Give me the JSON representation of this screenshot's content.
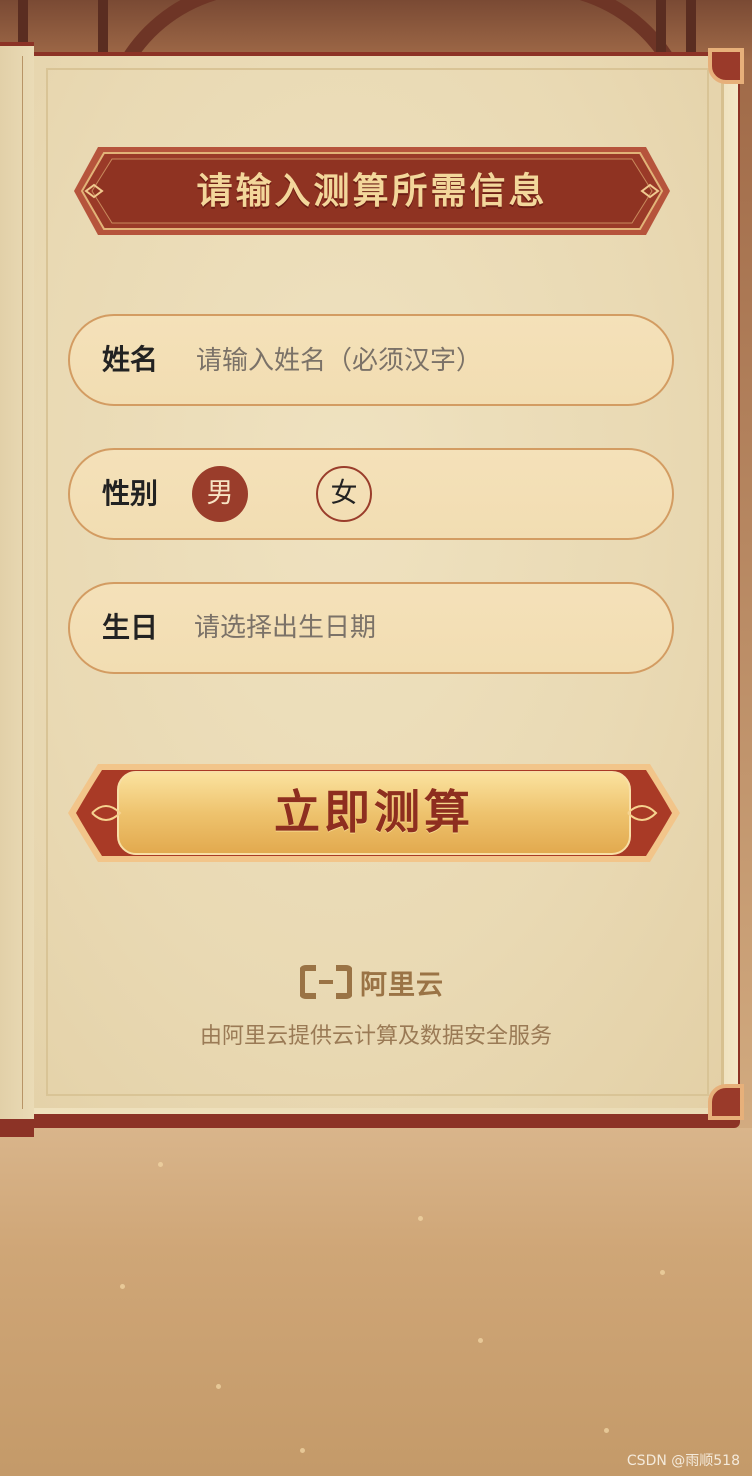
{
  "form": {
    "title": "请输入测算所需信息",
    "name": {
      "label": "姓名",
      "placeholder": "请输入姓名（必须汉字）",
      "value": ""
    },
    "gender": {
      "label": "性别",
      "options": [
        "男",
        "女"
      ],
      "selected": "男"
    },
    "birthday": {
      "label": "生日",
      "placeholder": "请选择出生日期"
    },
    "submit_label": "立即测算"
  },
  "footer": {
    "brand": "阿里云",
    "provider_text": "由阿里云提供云计算及数据安全服务"
  },
  "watermark": "CSDN @雨顺518",
  "colors": {
    "primary_red": "#9a3d2b",
    "gold_text": "#f3d79b",
    "field_border": "#d39c62",
    "paper": "#eadbb5"
  },
  "icons": [
    "aliyun-logo-icon"
  ]
}
